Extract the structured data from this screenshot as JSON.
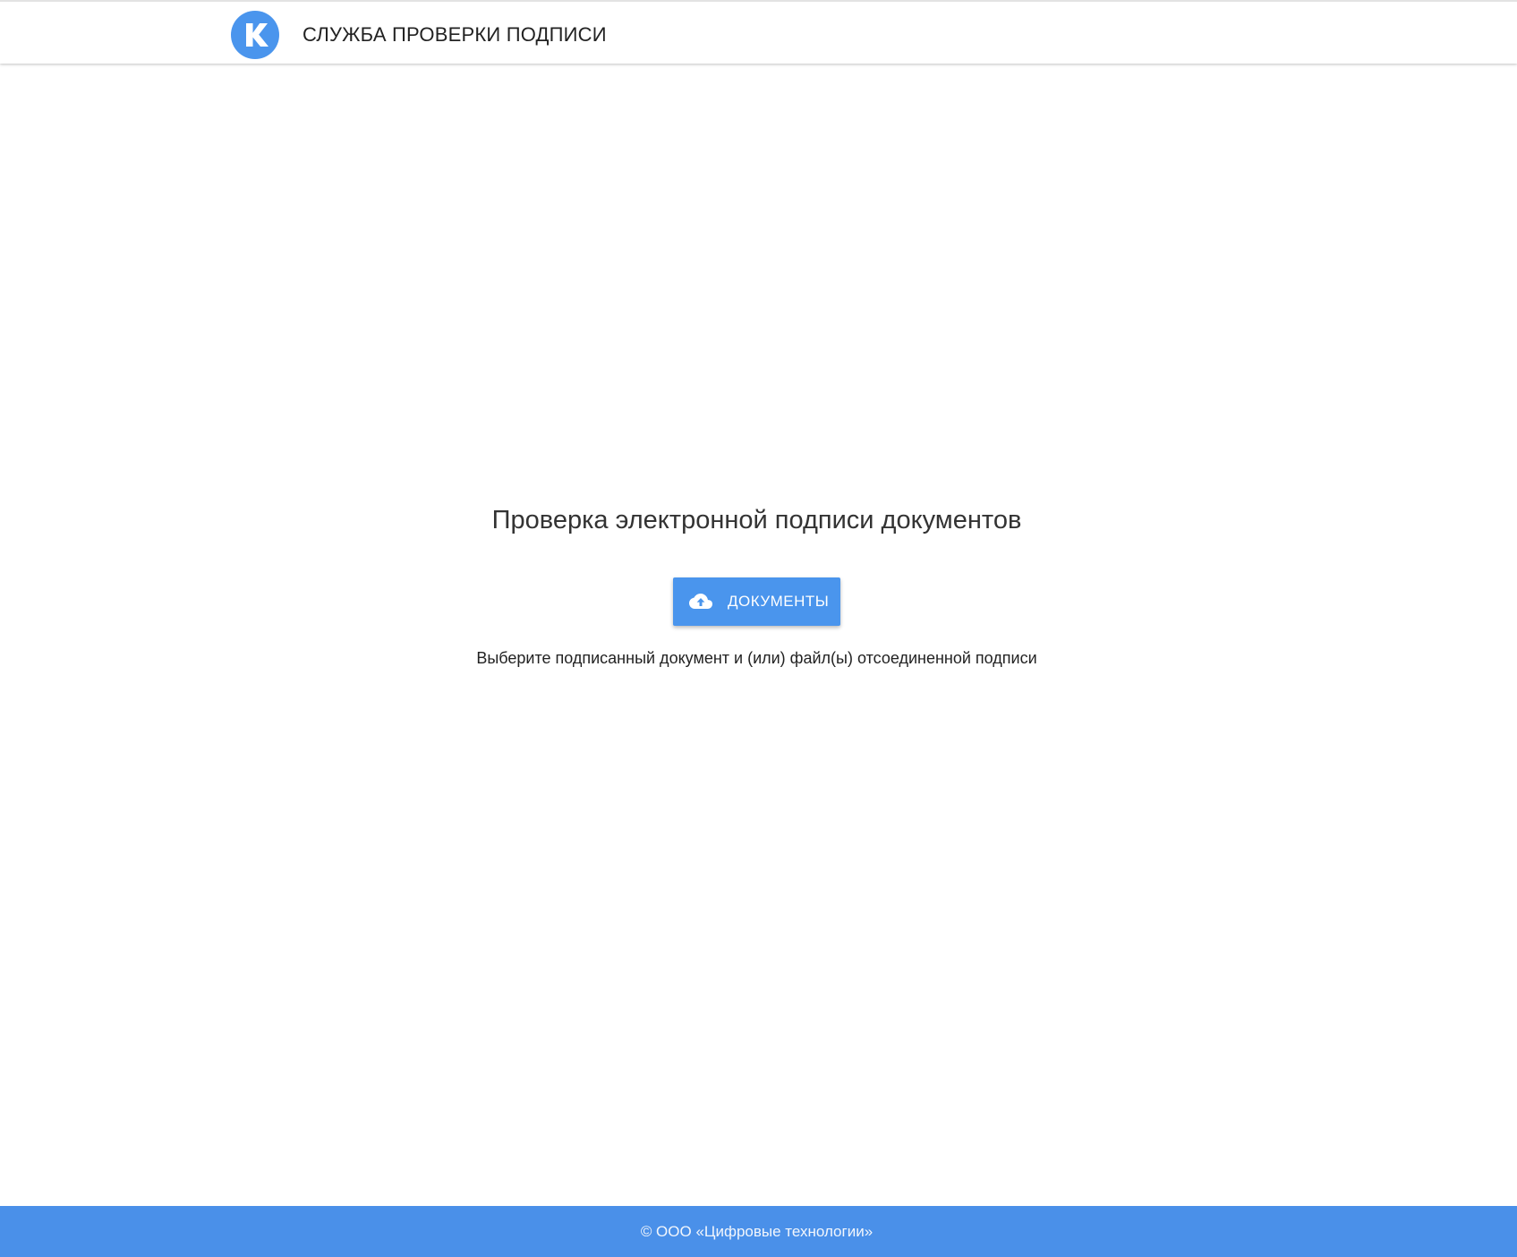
{
  "header": {
    "logo_icon": "k-logo-icon",
    "title": "СЛУЖБА ПРОВЕРКИ ПОДПИСИ"
  },
  "main": {
    "title": "Проверка электронной подписи документов",
    "upload_button": {
      "icon": "cloud-upload-icon",
      "label": "ДОКУМЕНТЫ"
    },
    "hint": "Выберите подписанный документ и (или) файл(ы) отсоединенной подписи"
  },
  "footer": {
    "copyright": "© ООО «Цифровые технологии»"
  },
  "colors": {
    "accent": "#4a95ed",
    "footer_bg": "#4a90e9",
    "background": "#ffffff",
    "text": "#222222"
  }
}
